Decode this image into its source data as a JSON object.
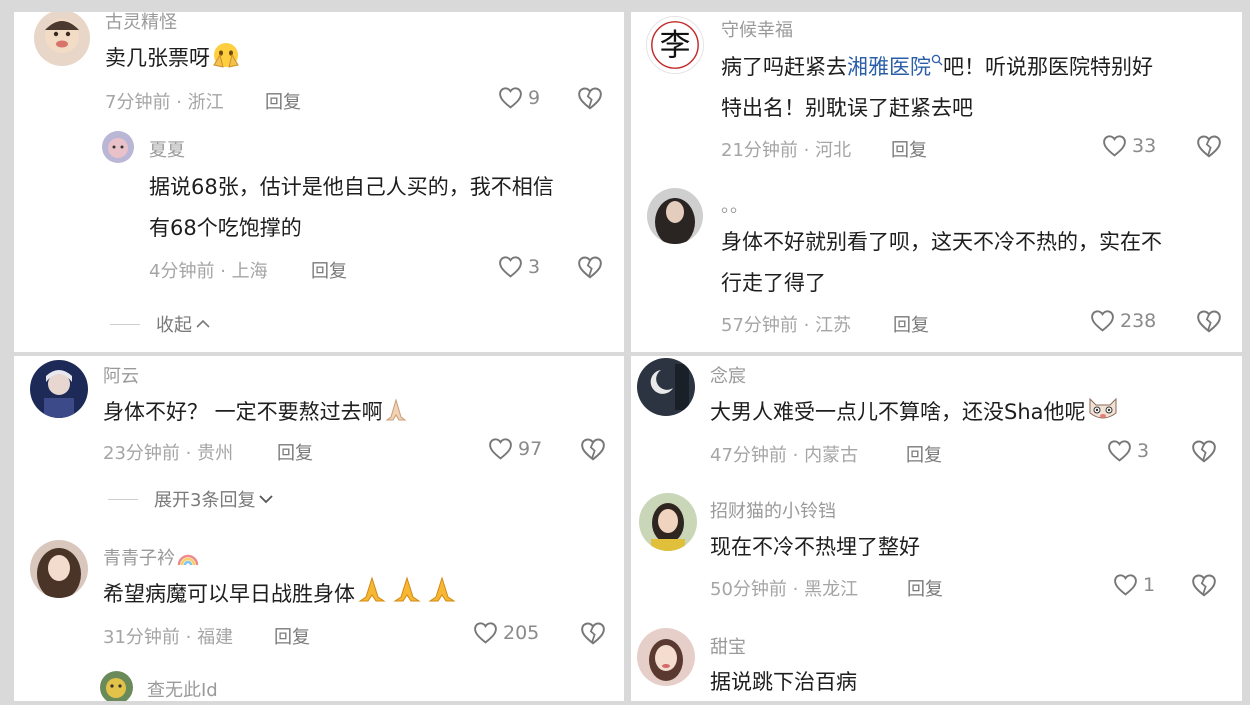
{
  "comments": [
    {
      "username": "古灵精怪",
      "text": "卖几张票呀",
      "time": "7分钟前",
      "location": "浙江",
      "reply_label": "回复",
      "likes": "9"
    },
    {
      "username": "夏夏",
      "text_line1": "据说68张，估计是他自己人买的，我不相信",
      "text_line2": "有68个吃饱撑的",
      "time": "4分钟前",
      "location": "上海",
      "reply_label": "回复",
      "likes": "3",
      "collapse_label": "收起"
    },
    {
      "username": "守候幸福",
      "text_before_link": "病了吗赶紧去",
      "link_text": "湘雅医院",
      "text_after_link": "吧！听说那医院特别好",
      "text_line2": "特出名！别耽误了赶紧去吧",
      "time": "21分钟前",
      "location": "河北",
      "reply_label": "回复",
      "likes": "33",
      "avatar_char": "李"
    },
    {
      "username": "。。",
      "text_line1": "身体不好就别看了呗，这天不冷不热的，实在不",
      "text_line2": "行走了得了",
      "time": "57分钟前",
      "location": "江苏",
      "reply_label": "回复",
      "likes": "238"
    },
    {
      "username": "阿云",
      "text": "身体不好？ 一定不要熬过去啊",
      "time": "23分钟前",
      "location": "贵州",
      "reply_label": "回复",
      "likes": "97",
      "expand_label": "展开3条回复"
    },
    {
      "username": "青青子衿",
      "text": "希望病魔可以早日战胜身体",
      "time": "31分钟前",
      "location": "福建",
      "reply_label": "回复",
      "likes": "205"
    },
    {
      "username": "查无此Id"
    },
    {
      "username": "念宸",
      "text": "大男人难受一点儿不算啥，还没Sha他呢",
      "time": "47分钟前",
      "location": "内蒙古",
      "reply_label": "回复",
      "likes": "3"
    },
    {
      "username": "招财猫的小铃铛",
      "text": "现在不冷不热埋了整好",
      "time": "50分钟前",
      "location": "黑龙江",
      "reply_label": "回复",
      "likes": "1"
    },
    {
      "username": "甜宝",
      "text": "据说跳下治百病"
    }
  ],
  "icons": {
    "like": "heart-outline-icon",
    "dislike": "broken-heart-icon",
    "search": "search-icon",
    "chevron_up": "chevron-up-icon",
    "chevron_down": "chevron-down-icon"
  },
  "meta_separator": "·",
  "colors": {
    "link": "#2a5fa8",
    "text": "#1e1e1e",
    "meta": "#a5a5a5",
    "background": "#ffffff",
    "divider": "#d9d9d9"
  }
}
